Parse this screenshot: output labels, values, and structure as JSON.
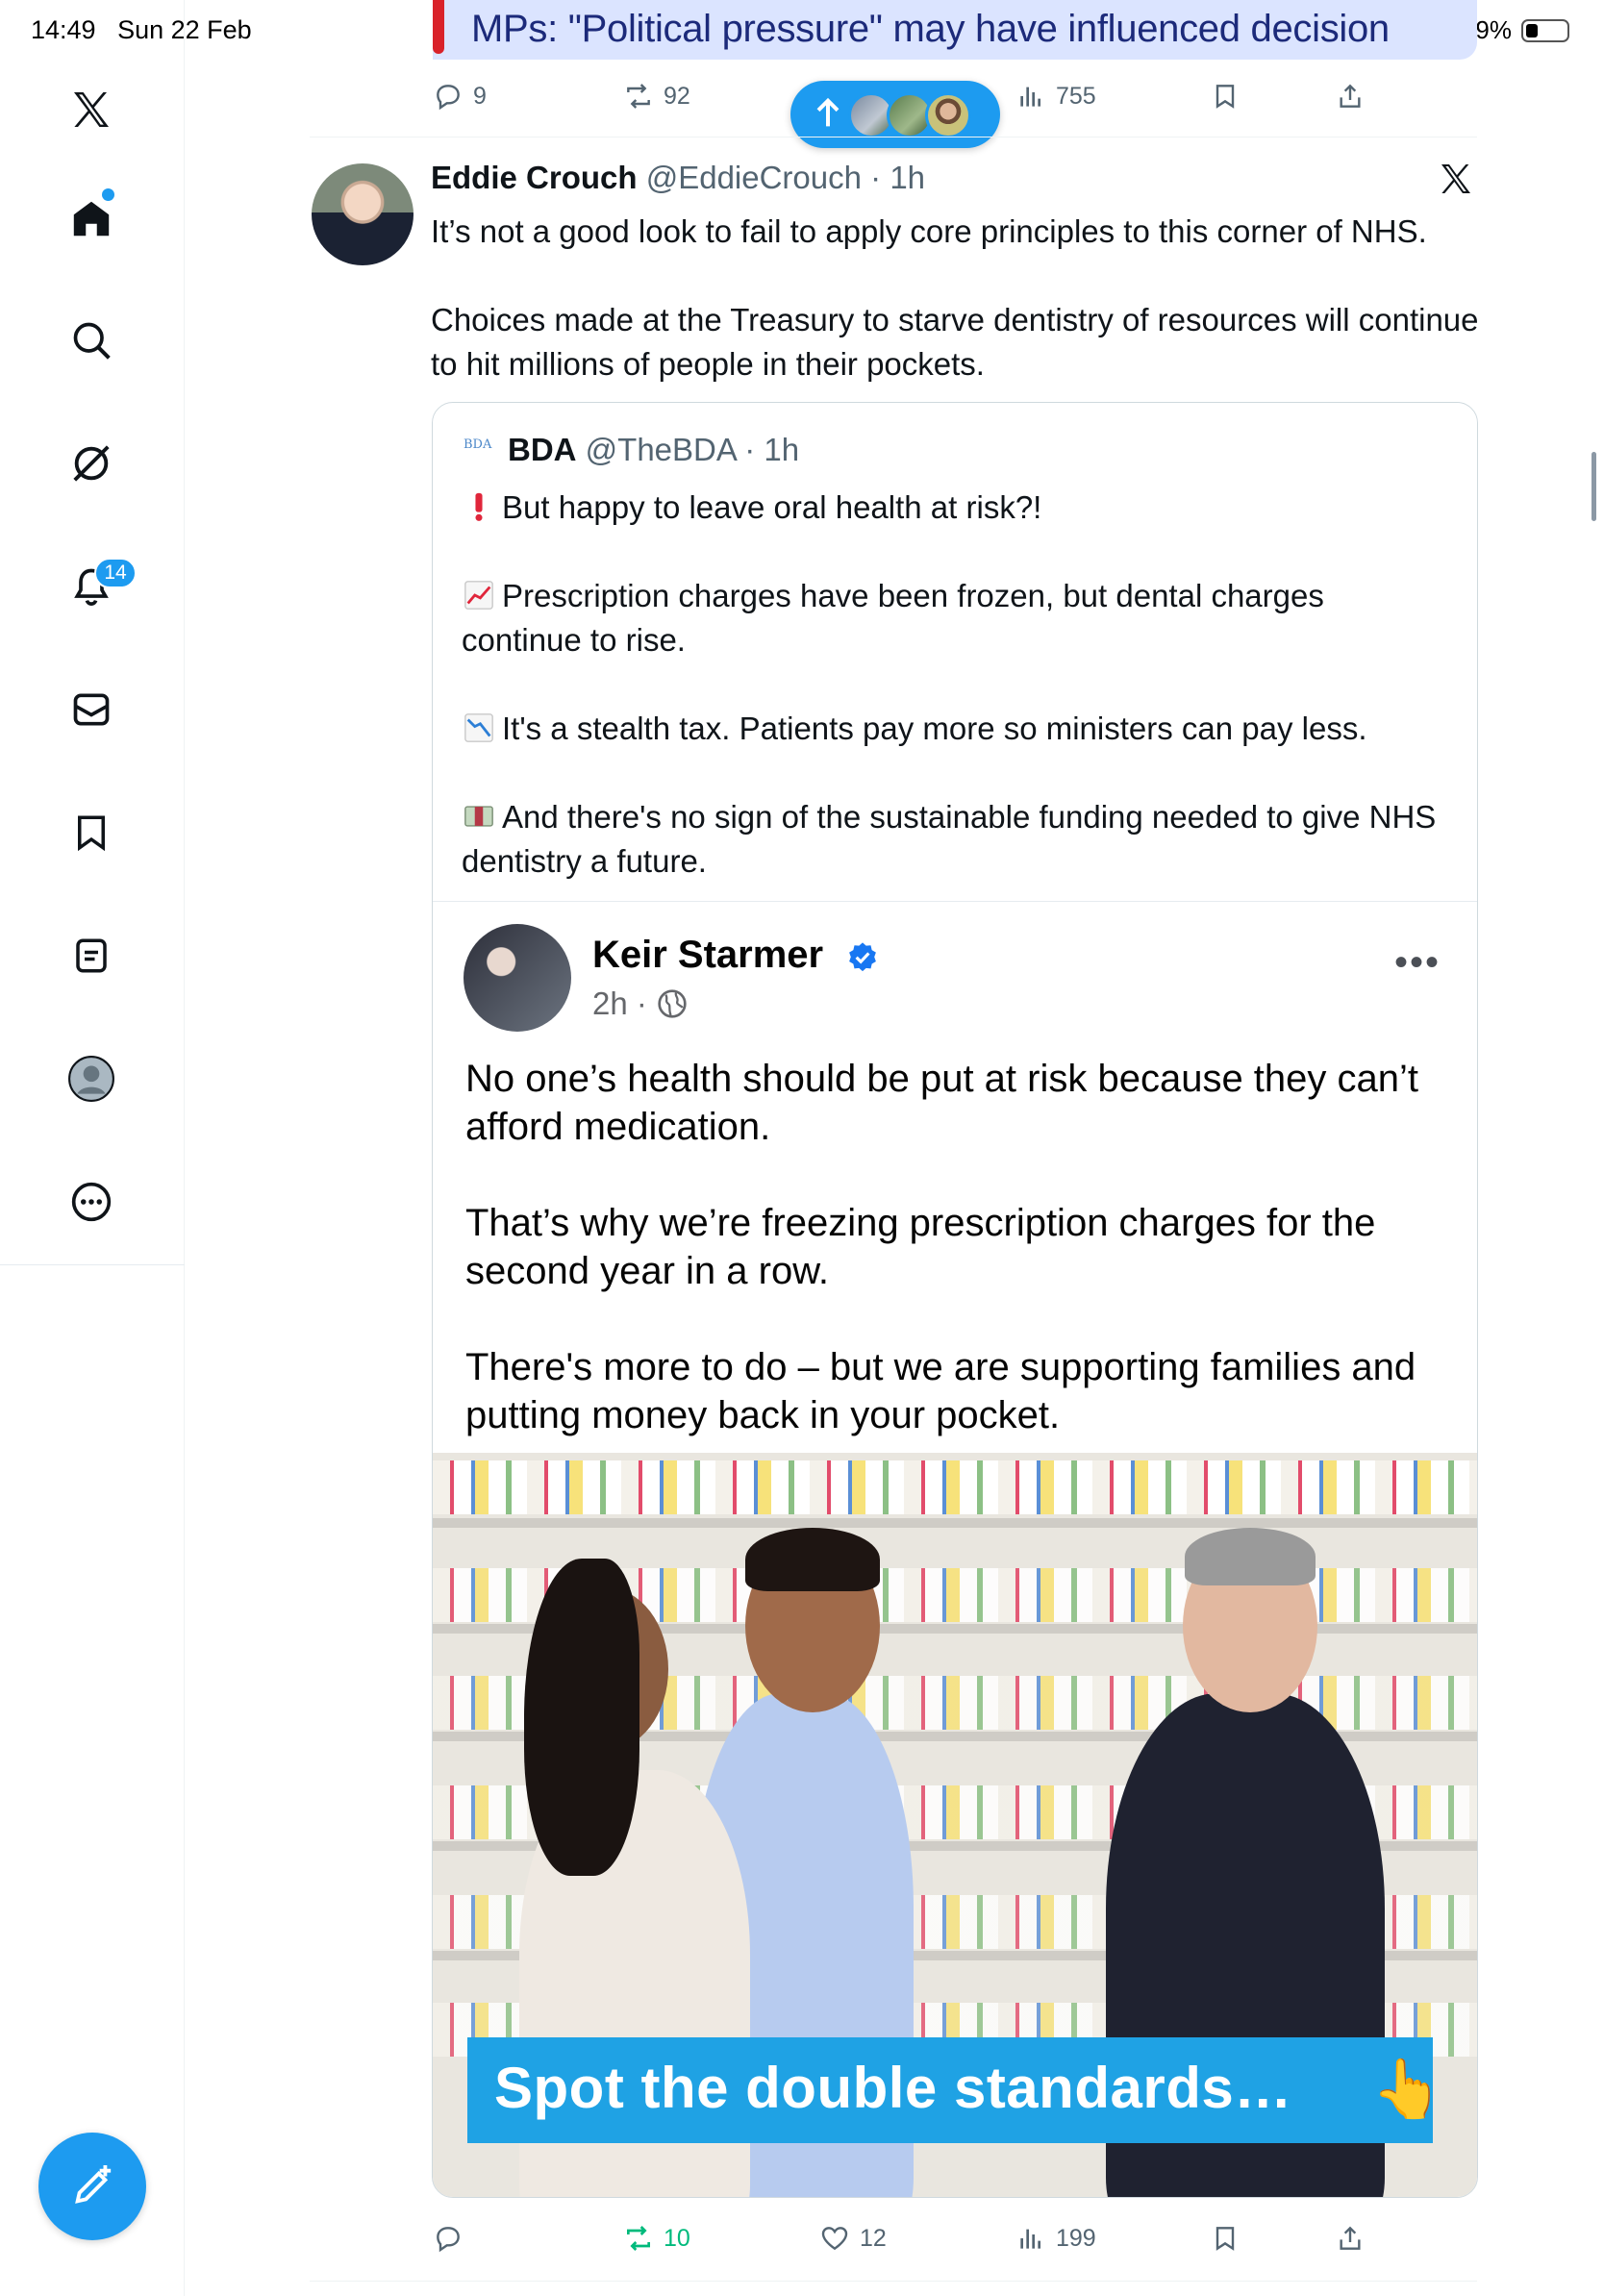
{
  "status_bar": {
    "time": "14:49",
    "date": "Sun 22 Feb",
    "battery": "29%",
    "battery_level": 0.29
  },
  "sidebar": {
    "items": [
      {
        "icon": "x-logo-icon"
      },
      {
        "icon": "home-icon"
      },
      {
        "icon": "search-icon"
      },
      {
        "icon": "grok-icon"
      },
      {
        "icon": "bell-icon",
        "badge": "14"
      },
      {
        "icon": "mail-icon"
      },
      {
        "icon": "bookmark-icon"
      },
      {
        "icon": "list-icon"
      },
      {
        "icon": "profile-icon"
      },
      {
        "icon": "more-icon"
      }
    ],
    "compose_icon": "compose-post-icon"
  },
  "top_tweet": {
    "banner_text": "MPs: \"Political pressure\" may have influenced decision",
    "replies": "9",
    "reposts": "92",
    "views": "755"
  },
  "new_posts_pill": {
    "icon": "arrow-up-icon"
  },
  "tweet": {
    "author_name": "Eddie Crouch",
    "author_handle": "@EddieCrouch",
    "time": "· 1h",
    "text_p1": "It’s not a good look to fail to apply core principles to this corner of NHS.",
    "text_p2": "Choices made at the Treasury to starve dentistry of resources will continue to hit millions of people in their pockets.",
    "replies": "",
    "reposts": "10",
    "likes": "12",
    "views": "199",
    "colors": {
      "repost_active": "#00ba7c",
      "accent": "#1d9bf0"
    }
  },
  "quote": {
    "logo_text": "BDA",
    "author_name": "BDA",
    "author_handle": "@TheBDA",
    "time": "· 1h",
    "line1": "But happy to leave oral health at risk?!",
    "line2": "Prescription charges have been frozen, but dental charges continue to rise.",
    "line3": "It's a stealth tax. Patients pay more so ministers can pay less.",
    "line4": "And there's no sign of the sustainable funding needed to give NHS dentistry a future.",
    "embedded_post": {
      "name": "Keir Starmer",
      "time": "2h ·",
      "more": "•••",
      "para1": "No one’s health should be put at risk because they can’t afford medication.",
      "para2": "That’s why we’re freezing prescription charges for the second year in a row.",
      "para3": "There's more to do – but we are supporting families and putting money back in your pocket.",
      "photo_caption": "Spot the double standards…",
      "photo_caption_emoji": "👆"
    }
  }
}
